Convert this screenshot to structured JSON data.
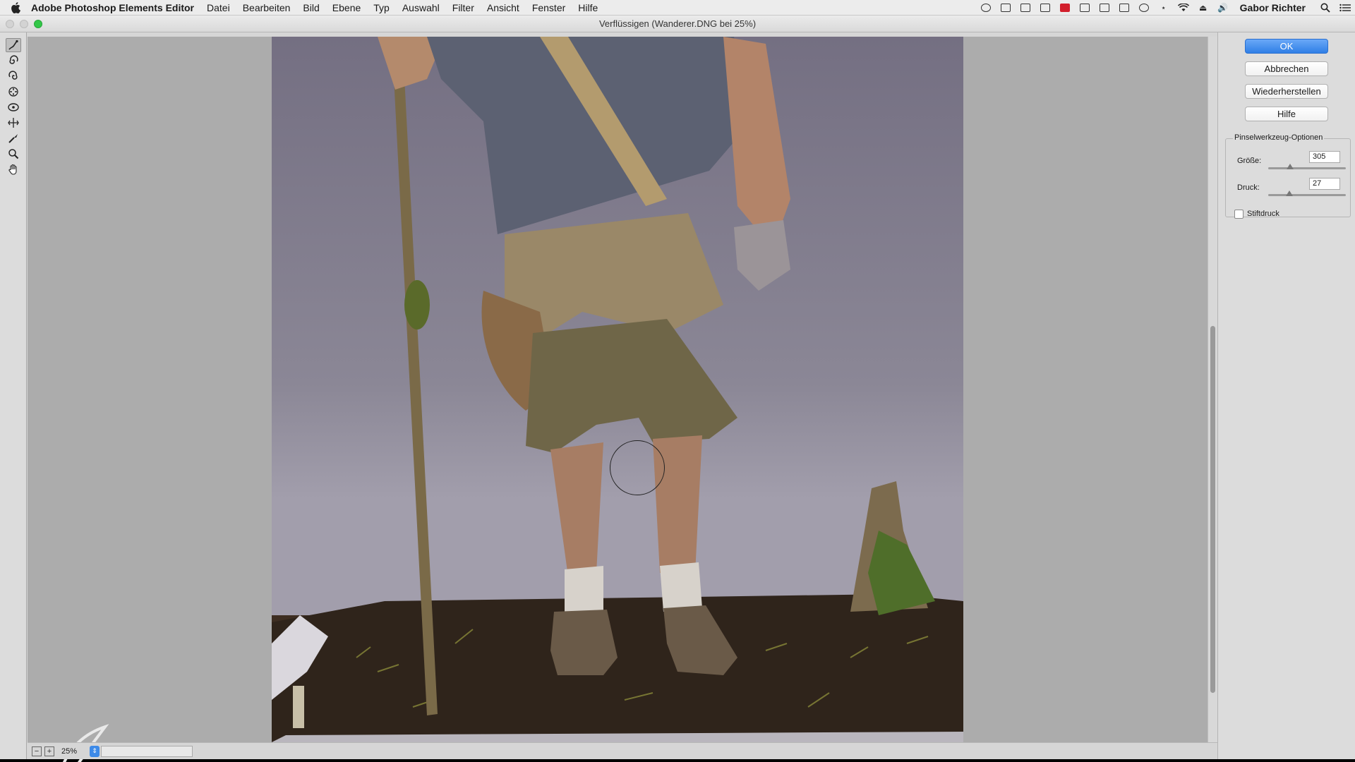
{
  "menubar": {
    "app_name": "Adobe Photoshop Elements Editor",
    "items": [
      "Datei",
      "Bearbeiten",
      "Bild",
      "Ebene",
      "Typ",
      "Auswahl",
      "Filter",
      "Ansicht",
      "Fenster",
      "Hilfe"
    ],
    "user": "Gabor Richter",
    "status_icons": [
      "record-icon",
      "display-icon",
      "cloud-icon",
      "evernote-icon",
      "adobe-icon",
      "drive-icon",
      "transfer-icon",
      "screen-icon",
      "time-machine-icon",
      "bluetooth-icon",
      "wifi-icon",
      "eject-icon",
      "volume-icon"
    ]
  },
  "window": {
    "title": "Verflüssigen (Wanderer.DNG bei 25%)"
  },
  "buttons": {
    "ok": "OK",
    "cancel": "Abbrechen",
    "restore": "Wiederherstellen",
    "help": "Hilfe"
  },
  "brush_options": {
    "title": "Pinselwerkzeug-Optionen",
    "size_label": "Größe:",
    "size_value": "305",
    "pressure_label": "Druck:",
    "pressure_value": "27",
    "stylus_label": "Stiftdruck",
    "stylus_checked": false
  },
  "statusbar": {
    "zoom": "25%"
  },
  "tools": [
    "warp-tool-icon",
    "twirl-clockwise-icon",
    "twirl-counterclockwise-icon",
    "pucker-icon",
    "bloat-icon",
    "shift-pixels-icon",
    "reconstruct-icon",
    "zoom-icon",
    "hand-icon"
  ],
  "colors": {
    "accent": "#2f7fe6",
    "canvas_bg": "#acacac"
  }
}
